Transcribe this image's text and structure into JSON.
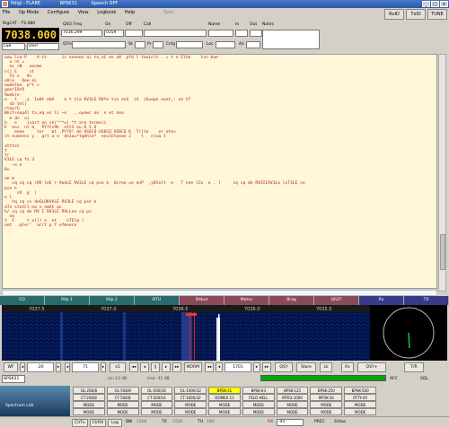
{
  "app": {
    "title": "fldigi - FLARE",
    "subtitle": "BPSK31",
    "extra": "Speech OFF"
  },
  "menu": [
    "File",
    "Op Mode",
    "Configure",
    "View",
    "Logbook",
    "Help"
  ],
  "menu_disabled": "Spot",
  "top_buttons": [
    "RxID",
    "TxID",
    "TUNE"
  ],
  "rig": {
    "name": "RigCAT - TS-480",
    "freq": "7038.000",
    "mode": "LSB",
    "bw": "DSH"
  },
  "log": {
    "qso_freq_label": "QSO Freq",
    "qso_freq": "7036.299",
    "on_label": "On",
    "on": "0359",
    "off_label": "Off",
    "call_label": "Call",
    "name_label": "Name",
    "in_label": "In",
    "out_label": "Out",
    "notes_label": "Notes",
    "qth_label": "QTH",
    "st_label": "St",
    "pr_label": "Pr",
    "cnty_label": "Cnty",
    "loc_label": "Loc",
    "az_label": "Az"
  },
  "rx_text": [
    "oow lca-P    A-st      ic eeeeen ai tn_aC ee a¥  pfd l taeinlt . = t e Elhe    tvn bae",
    "  a nt =",
    "  es cN   eenme",
    "n(j E     st",
    "  tS n   #s",
    "oV|e_  Oee eL",
    "owebtoe  p^t v",
    "goerIOrD",
    "9web(e",
    "o   t   _a  1e0t ebH    o t tia RV3LE RVYe tie enä  i4  iO=opn ooet,: ee hT",
    "  sD tel|",
    "ctep/G",
    "Wnit+onp4l tx,eq es li ~e   ..oyewr oe  n et neo",
    "  e dn  oi",
    "h   e    isart nn sh(^^*u) *t aro terme(i",
    "E  eoi  nt b_  PY7ts9k  ett3 ou D S Q",
    "    eeee     ter   bt ,PY7V! de US6CQ US6CQ US6CQ K  Tr]te    er ate<",
    "it eueenns y   grt a e  de1a=*tgdhle*  eeulEtoeae 2    t   n(ua t",
    "",
    "atttet",
    "t",
    "tr",
    "V3LE cq fx 3",
    "   ~o e",
    "0=",
    "",
    "an m",
    "   cq cq cq rOV leE r 9ooLE RV3LE cq pse k  Qsreo =e enP  ,yBtolt  e   T nee lCe  e . ]     cq cq de RV3IIAV3Lo lnT3LE ce",
    "pse k",
    "     sO  g  )",
    "e l",
    "   hq cq cs deGLQKVkLE RV3LE cq pse k",
    "aTn stotCl-no n emAt as",
    "h/ cq cq de RV I RV3LE RVLLeo cq ps",
    "  no",
    "t  F     t o(l) o  et    oTEl@ (",
    "oet   @ler'  acrt p f efmeece"
  ],
  "macros": [
    {
      "label": "CQ",
      "color": "#2a6a6a"
    },
    {
      "label": "Rép 1",
      "color": "#2a6a6a"
    },
    {
      "label": "Rép 2",
      "color": "#2a6a6a"
    },
    {
      "label": "BTU",
      "color": "#2a6a6a"
    },
    {
      "label": "Début",
      "color": "#8a4a5a"
    },
    {
      "label": "Matos",
      "color": "#8a4a5a"
    },
    {
      "label": "Brag",
      "color": "#8a4a5a"
    },
    {
      "label": "QRZ?",
      "color": "#8a4a5a"
    },
    {
      "label": "Rx",
      "color": "#3a3a8a"
    },
    {
      "label": "TX",
      "color": "#3a3a8a"
    }
  ],
  "wf_scale": [
    "7037.5",
    "7037.0",
    "7036.5",
    "7036.0",
    "7035.5",
    "7035.0"
  ],
  "ctl": {
    "wf": "WF",
    "neg": "-20",
    "val": "71",
    "x1": "x1",
    "norm": "NORM",
    "freq": "1701",
    "qsy": "QSY",
    "store": "Store",
    "lk": "Lk",
    "rev": "Rv",
    "t_r": "T/R",
    "afc": "AFC",
    "sql": "SQL",
    "qsyplus": "QSY+"
  },
  "mode_label": "BPSK31",
  "s2n": "s/n 13 dB",
  "imd": "imd -32 dB",
  "mode_rows": [
    [
      "OL-2S6/8",
      "OL-5S6/8",
      "OL-500/16",
      "OL-1000/32",
      "BPSK-31",
      "BPSK-63",
      "BPSK-125",
      "BPSK-250",
      "BPSK-500"
    ],
    [
      "CT-2S6/8",
      "CT-5S6/8",
      "CT-500/16",
      "CT-1000/32",
      "DOMEX 11",
      "FELD HELL",
      "MT63-1000",
      "MFSK-16",
      "RTTY-45"
    ],
    [
      "MODE",
      "MODE",
      "MODE",
      "MODE",
      "MODE",
      "MODE",
      "MODE",
      "MODE",
      "MODE"
    ],
    [
      "MODE",
      "MODE",
      "MODE",
      "MODE",
      "MODE",
      "MODE",
      "MODE",
      "MODE",
      "MODE"
    ]
  ],
  "bottom": {
    "clrtx": "ClrTx",
    "clrrx": "ClrRX",
    "log": "Log",
    "bw": "BW",
    "bw_val": "1000",
    "tx": "TX",
    "tx_val": "1500",
    "th": "TH",
    "th_val": "180",
    "rx": "RX",
    "rx_val": "-45",
    "prec": "PREC",
    "s4a": "S/4aa"
  },
  "thumb": "Spectrum Lab"
}
